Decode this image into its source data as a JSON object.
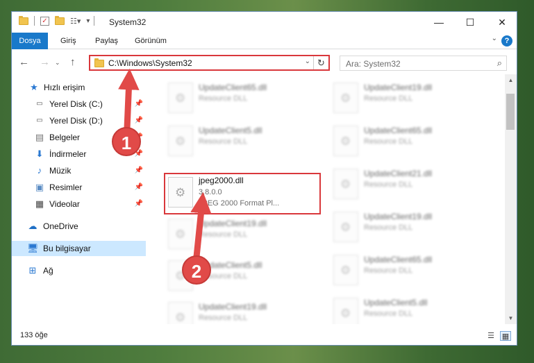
{
  "window": {
    "title": "System32",
    "controls": {
      "minimize": "—",
      "maximize": "☐",
      "close": "✕"
    }
  },
  "ribbon": {
    "tabs": [
      "Dosya",
      "Giriş",
      "Paylaş",
      "Görünüm"
    ],
    "help": "?"
  },
  "nav": {
    "address": "C:\\Windows\\System32",
    "search_placeholder": "Ara: System32"
  },
  "sidebar": {
    "items": [
      {
        "label": "Hızlı erişim",
        "icon": "star-icon"
      },
      {
        "label": "Yerel Disk (C:)",
        "icon": "drive-icon",
        "pinned": true
      },
      {
        "label": "Yerel Disk (D:)",
        "icon": "drive-icon",
        "pinned": true
      },
      {
        "label": "Belgeler",
        "icon": "document-icon",
        "pinned": true
      },
      {
        "label": "İndirmeler",
        "icon": "download-icon",
        "pinned": true
      },
      {
        "label": "Müzik",
        "icon": "music-icon",
        "pinned": true
      },
      {
        "label": "Resimler",
        "icon": "pictures-icon",
        "pinned": true
      },
      {
        "label": "Videolar",
        "icon": "video-icon",
        "pinned": true
      },
      {
        "label": "OneDrive",
        "icon": "cloud-icon"
      },
      {
        "label": "Bu bilgisayar",
        "icon": "computer-icon",
        "selected": true
      },
      {
        "label": "Ağ",
        "icon": "network-icon"
      }
    ]
  },
  "files": {
    "left_column": [
      {
        "name": "UpdateClient65.dll",
        "desc": "Resource DLL"
      },
      {
        "name": "UpdateClient5.dll",
        "desc": "Resource DLL"
      },
      {
        "name": "jpeg2000.dll",
        "version": "3.8.0.0",
        "desc": "JPEG 2000 Format Pl...",
        "highlighted": true
      },
      {
        "name": "UpdateClient19.dll",
        "desc": "Resource DLL"
      },
      {
        "name": "UpdateClient5.dll",
        "desc": "Resource DLL"
      },
      {
        "name": "UpdateClient19.dll",
        "desc": "Resource DLL"
      }
    ],
    "right_column": [
      {
        "name": "UpdateClient19.dll",
        "desc": "Resource DLL"
      },
      {
        "name": "UpdateClient65.dll",
        "desc": "Resource DLL"
      },
      {
        "name": "UpdateClient21.dll",
        "desc": "Resource DLL"
      },
      {
        "name": "UpdateClient19.dll",
        "desc": "Resource DLL"
      },
      {
        "name": "UpdateClient65.dll",
        "desc": "Resource DLL"
      },
      {
        "name": "UpdateClient5.dll",
        "desc": "Resource DLL"
      }
    ]
  },
  "status": {
    "count": "133 öğe"
  },
  "annotations": {
    "step1": "1",
    "step2": "2",
    "color": "#e14a48"
  }
}
